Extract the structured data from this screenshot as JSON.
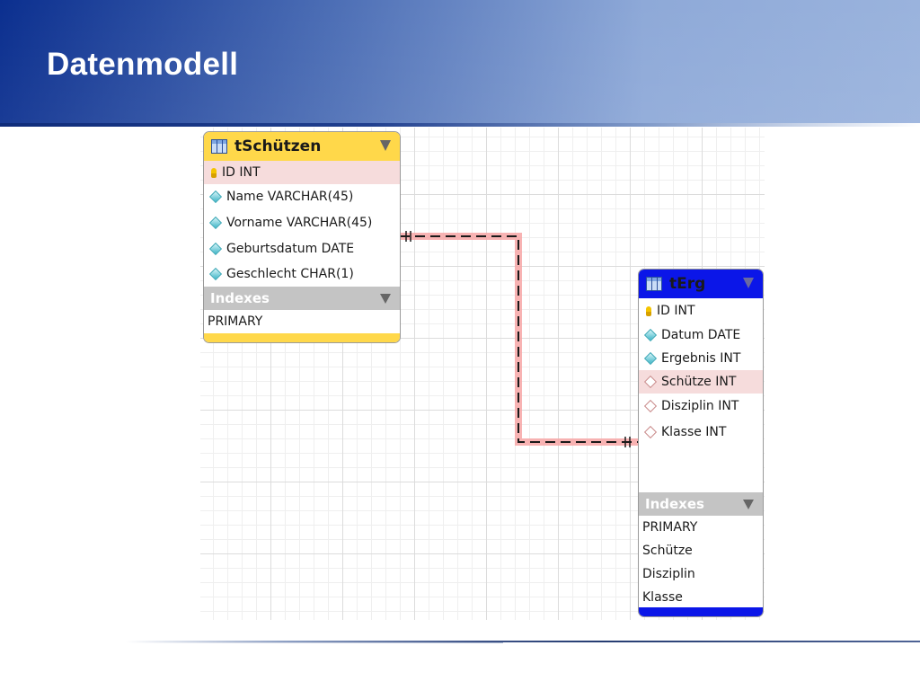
{
  "slide": {
    "title": "Datenmodell"
  },
  "entities": {
    "tschuetzen": {
      "name": "tSchützen",
      "header_color": "#ffd84a",
      "columns": [
        {
          "label": "ID INT",
          "icon": "key-icon"
        },
        {
          "label": "Name VARCHAR(45)",
          "icon": "diamond-icon"
        },
        {
          "label": "Vorname VARCHAR(45)",
          "icon": "diamond-icon"
        },
        {
          "label": "Geburtsdatum DATE",
          "icon": "diamond-icon"
        },
        {
          "label": "Geschlecht CHAR(1)",
          "icon": "diamond-icon"
        }
      ],
      "indexes_label": "Indexes",
      "indexes": [
        "PRIMARY"
      ]
    },
    "terg": {
      "name": "tErg",
      "header_color": "#0b16e8",
      "columns": [
        {
          "label": "ID INT",
          "icon": "key-icon"
        },
        {
          "label": "Datum DATE",
          "icon": "diamond-icon"
        },
        {
          "label": "Ergebnis INT",
          "icon": "diamond-icon"
        },
        {
          "label": "Schütze INT",
          "icon": "foreign-key-diamond-icon"
        },
        {
          "label": "Disziplin INT",
          "icon": "foreign-key-diamond-icon"
        },
        {
          "label": "Klasse INT",
          "icon": "foreign-key-diamond-icon"
        }
      ],
      "indexes_label": "Indexes",
      "indexes": [
        "PRIMARY",
        "Schütze",
        "Disziplin",
        "Klasse"
      ]
    }
  },
  "relationship": {
    "from": "tSchützen",
    "to": "tErg",
    "line_color": "#1a1a1a",
    "highlight_color": "#f7a6a6"
  }
}
